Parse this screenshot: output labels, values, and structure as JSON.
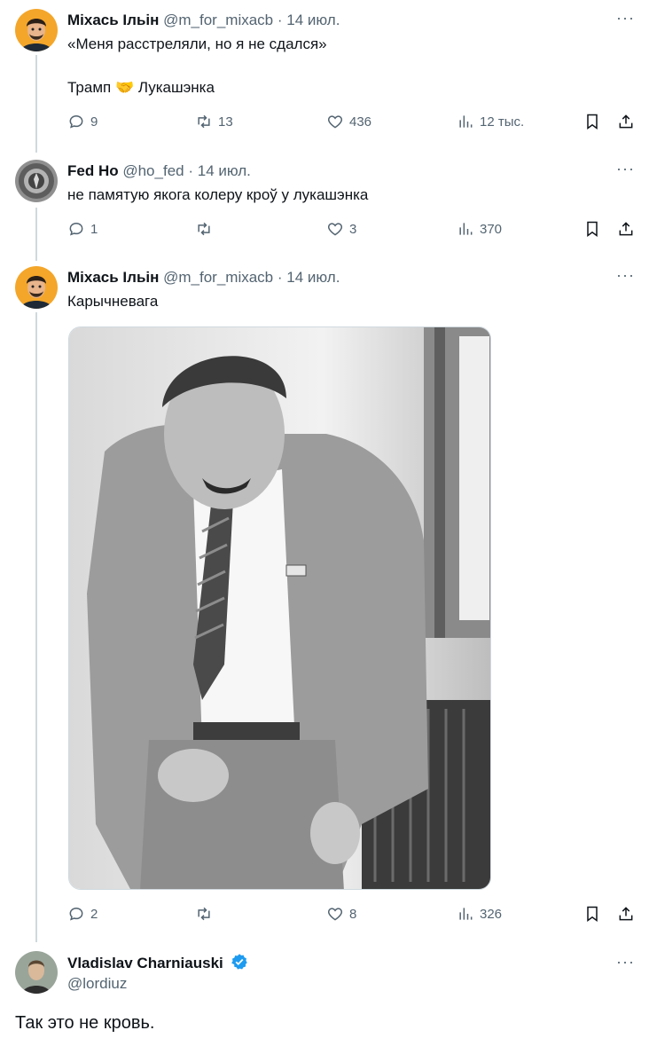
{
  "colors": {
    "text": "#0f1419",
    "muted": "#536471",
    "line": "#cfd9de",
    "verified": "#1d9bf0"
  },
  "tweets": [
    {
      "name": "Міхась Ільін",
      "handle": "@m_for_mixacb",
      "dot": "·",
      "date": "14 июл.",
      "more": "···",
      "lines": [
        "«Меня расстреляли, но я не сдался»",
        "Трамп 🤝 Лукашэнка"
      ],
      "stats": {
        "replies": "9",
        "retweets": "13",
        "likes": "436",
        "views": "12 тыс."
      }
    },
    {
      "name": "Fed Ho",
      "handle": "@ho_fed",
      "dot": "·",
      "date": "14 июл.",
      "more": "···",
      "lines": [
        "не памятую якога колеру кроў у лукашэнка"
      ],
      "stats": {
        "replies": "1",
        "retweets": "",
        "likes": "3",
        "views": "370"
      }
    },
    {
      "name": "Міхась Ільін",
      "handle": "@m_for_mixacb",
      "dot": "·",
      "date": "14 июл.",
      "more": "···",
      "lines": [
        "Карычневага"
      ],
      "stats": {
        "replies": "2",
        "retweets": "",
        "likes": "8",
        "views": "326"
      }
    }
  ],
  "main_tweet": {
    "name": "Vladislav Charniauski",
    "handle": "@lordiuz",
    "more": "···",
    "text": "Так это не кровь."
  }
}
